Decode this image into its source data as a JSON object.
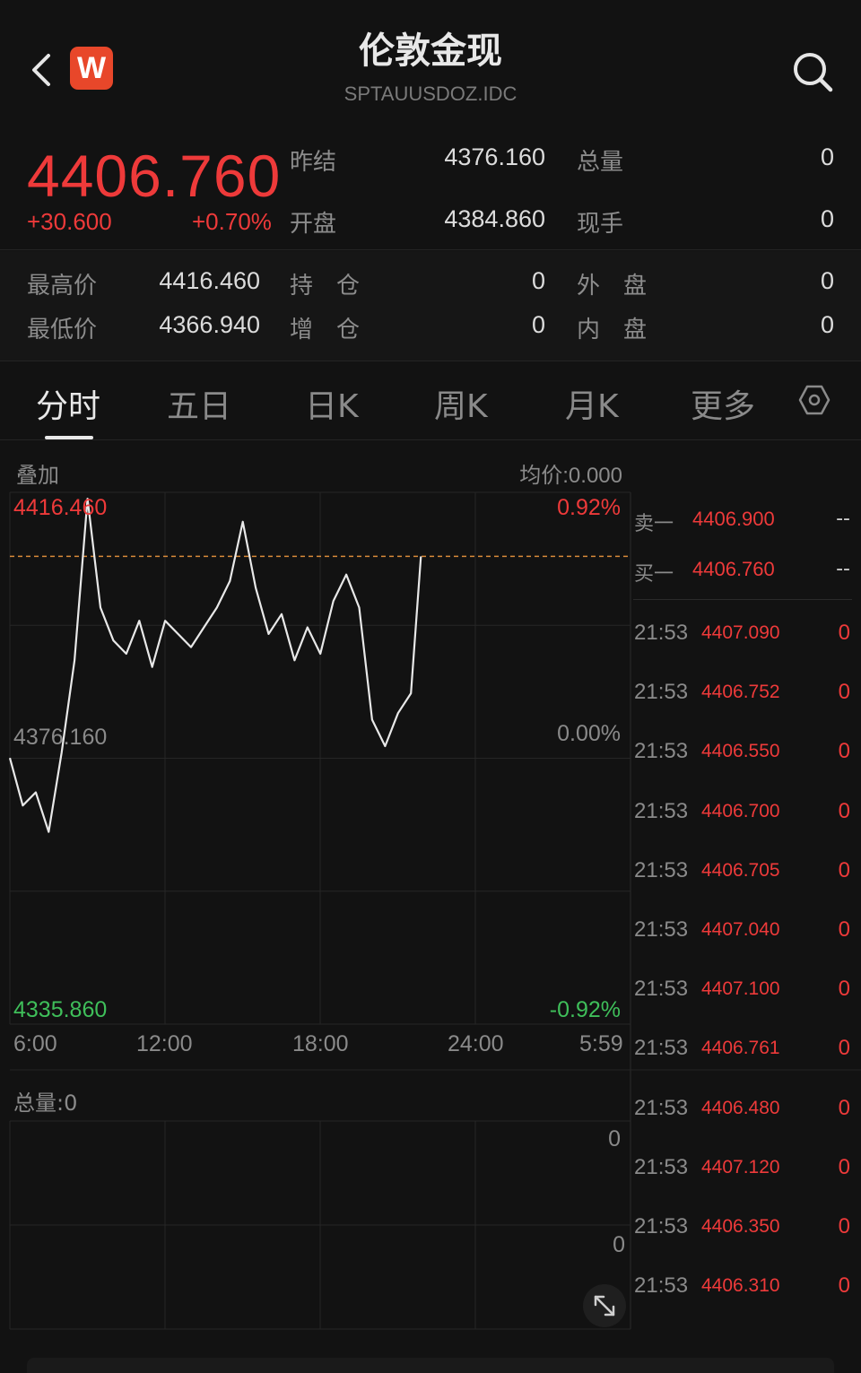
{
  "header": {
    "title": "伦敦金现",
    "subtitle": "SPTAUUSDOZ.IDC",
    "logo_letter": "W"
  },
  "quote": {
    "price": "4406.760",
    "change": "+30.600",
    "change_pct": "+0.70%",
    "prev_close_label": "昨结",
    "prev_close": "4376.160",
    "open_label": "开盘",
    "open": "4384.860",
    "total_vol_label": "总量",
    "total_vol": "0",
    "cur_vol_label": "现手",
    "cur_vol": "0",
    "high_label": "最高价",
    "high": "4416.460",
    "low_label": "最低价",
    "low": "4366.940",
    "hold_label": "持　仓",
    "hold": "0",
    "inc_label": "增　仓",
    "inc": "0",
    "outer_label": "外　盘",
    "outer": "0",
    "inner_label": "内　盘",
    "inner": "0"
  },
  "tabs": [
    "分时",
    "五日",
    "日K",
    "周K",
    "月K",
    "更多"
  ],
  "active_tab": "分时",
  "chart": {
    "overlay_label": "叠加",
    "avg_price": "均价:0.000",
    "y_top": "4416.460",
    "y_mid": "4376.160",
    "y_bot": "4335.860",
    "pct_top": "0.92%",
    "pct_mid": "0.00%",
    "pct_bot": "-0.92%",
    "x_labels": [
      "6:00",
      "12:00",
      "18:00",
      "24:00",
      "5:59"
    ],
    "vol_label": "总量:0",
    "vol_top": "0",
    "vol_mid": "0"
  },
  "orderbook": {
    "sell_label": "卖一",
    "sell_price": "4406.900",
    "sell_vol": "--",
    "buy_label": "买一",
    "buy_price": "4406.760",
    "buy_vol": "--"
  },
  "trades": [
    {
      "time": "21:53",
      "price": "4407.090",
      "vol": "0"
    },
    {
      "time": "21:53",
      "price": "4406.752",
      "vol": "0"
    },
    {
      "time": "21:53",
      "price": "4406.550",
      "vol": "0"
    },
    {
      "time": "21:53",
      "price": "4406.700",
      "vol": "0"
    },
    {
      "time": "21:53",
      "price": "4406.705",
      "vol": "0"
    },
    {
      "time": "21:53",
      "price": "4407.040",
      "vol": "0"
    },
    {
      "time": "21:53",
      "price": "4407.100",
      "vol": "0"
    },
    {
      "time": "21:53",
      "price": "4406.761",
      "vol": "0"
    },
    {
      "time": "21:53",
      "price": "4406.480",
      "vol": "0"
    },
    {
      "time": "21:53",
      "price": "4407.120",
      "vol": "0"
    },
    {
      "time": "21:53",
      "price": "4406.350",
      "vol": "0"
    },
    {
      "time": "21:53",
      "price": "4406.310",
      "vol": "0"
    }
  ],
  "chart_data": {
    "type": "line",
    "x_tick_labels": [
      "6:00",
      "12:00",
      "18:00",
      "24:00",
      "5:59"
    ],
    "ylim": [
      4335.86,
      4416.46
    ],
    "reference": 4376.16,
    "last_price": 4406.76,
    "series": [
      {
        "x": [
          "6:00",
          "6:30",
          "7:00",
          "7:30",
          "8:00",
          "8:30",
          "9:00",
          "9:30",
          "10:00",
          "10:30",
          "11:00",
          "11:30",
          "12:00",
          "12:30",
          "13:00",
          "13:30",
          "14:00",
          "14:30",
          "15:00",
          "15:30",
          "16:00",
          "16:30",
          "17:00",
          "17:30",
          "18:00",
          "18:30",
          "19:00",
          "19:30",
          "20:00",
          "20:30",
          "21:00",
          "21:30",
          "21:53"
        ],
        "values": [
          4376.2,
          4369,
          4371,
          4365,
          4377,
          4391,
          4415.5,
          4399,
          4394,
          4392,
          4397,
          4390,
          4397,
          4395,
          4393,
          4396,
          4399,
          4403,
          4412,
          4402,
          4395,
          4398,
          4391,
          4396,
          4392,
          4400,
          4404,
          4399,
          4382,
          4378,
          4383,
          4386,
          4406.76
        ]
      }
    ],
    "grid": true
  }
}
